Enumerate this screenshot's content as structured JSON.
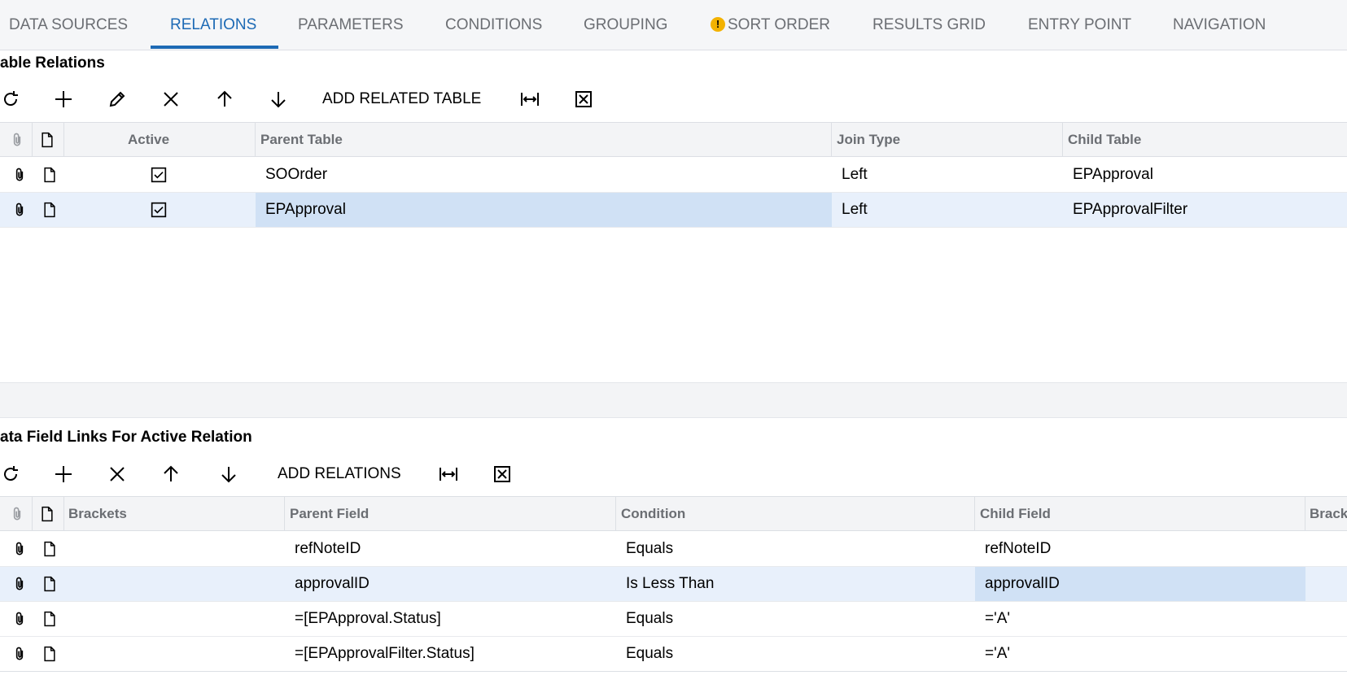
{
  "tabs": [
    {
      "label": "DATA SOURCES"
    },
    {
      "label": "RELATIONS"
    },
    {
      "label": "PARAMETERS"
    },
    {
      "label": "CONDITIONS"
    },
    {
      "label": "GROUPING"
    },
    {
      "label": "SORT ORDER"
    },
    {
      "label": "RESULTS GRID"
    },
    {
      "label": "ENTRY POINT"
    },
    {
      "label": "NAVIGATION"
    }
  ],
  "active_tab": "RELATIONS",
  "warning_tab": "SORT ORDER",
  "relations": {
    "title": "able Relations",
    "toolbar": {
      "add_related_table": "ADD RELATED TABLE"
    },
    "columns": {
      "active": "Active",
      "parent_table": "Parent Table",
      "join_type": "Join Type",
      "child_table": "Child Table"
    },
    "rows": [
      {
        "active": true,
        "parent_table": "SOOrder",
        "join_type": "Left",
        "child_table": "EPApproval"
      },
      {
        "active": true,
        "parent_table": "EPApproval",
        "join_type": "Left",
        "child_table": "EPApprovalFilter"
      }
    ]
  },
  "links": {
    "title": "ata Field Links For Active Relation",
    "toolbar": {
      "add_relations": "ADD RELATIONS"
    },
    "columns": {
      "brackets": "Brackets",
      "parent_field": "Parent Field",
      "condition": "Condition",
      "child_field": "Child Field",
      "brackets_close": "Brack"
    },
    "rows": [
      {
        "parent_field": "refNoteID",
        "condition": "Equals",
        "child_field": "refNoteID"
      },
      {
        "parent_field": "approvalID",
        "condition": "Is Less Than",
        "child_field": "approvalID"
      },
      {
        "parent_field": "=[EPApproval.Status]",
        "condition": "Equals",
        "child_field": "='A'"
      },
      {
        "parent_field": "=[EPApprovalFilter.Status]",
        "condition": "Equals",
        "child_field": "='A'"
      }
    ]
  },
  "colors": {
    "accent": "#1d6ab5",
    "warning": "#f3b200",
    "selected_row": "#e8f0fb",
    "selected_cell": "#d0e1f5"
  }
}
